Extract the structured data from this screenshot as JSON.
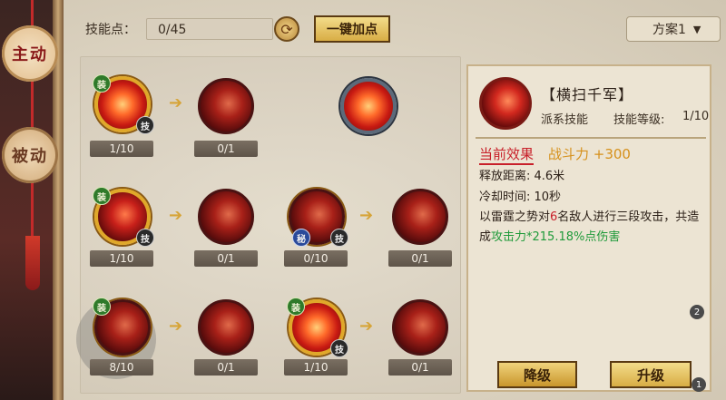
{
  "tabs": {
    "active": "主动",
    "inactive": "被动"
  },
  "topbar": {
    "skill_points_label": "技能点：",
    "skill_points_value": "0/45",
    "quick_assign_label": "一键加点",
    "plan_label": "方案1",
    "plan_chevron": "▼"
  },
  "skills": [
    {
      "level": "1/10",
      "badges": [
        "装",
        "技"
      ]
    },
    {
      "level": "0/1",
      "badges": []
    },
    {
      "level": "",
      "badges": []
    },
    {
      "level": "1/10",
      "badges": [
        "装",
        "技"
      ]
    },
    {
      "level": "0/1",
      "badges": []
    },
    {
      "level": "0/10",
      "badges": [
        "秘",
        "技"
      ]
    },
    {
      "level": "0/1",
      "badges": []
    },
    {
      "level": "8/10",
      "badges": [
        "装"
      ]
    },
    {
      "level": "0/1",
      "badges": []
    },
    {
      "level": "1/10",
      "badges": [
        "装",
        "技"
      ]
    },
    {
      "level": "0/1",
      "badges": []
    }
  ],
  "detail": {
    "name": "【横扫千军】",
    "type": "派系技能",
    "level_label": "技能等级:",
    "level_value": "1/10",
    "effect_title": "当前效果",
    "effect_value": "战斗力 +300",
    "range": "释放距离: 4.6米",
    "cooldown": "冷却时间: 10秒",
    "desc_prefix": "以雷霆之势对",
    "desc_count": "6",
    "desc_middle": "名敌人进行三段攻击，共造成",
    "desc_damage": "攻击力*215.18%点伤害"
  },
  "buttons": {
    "downgrade": "降级",
    "upgrade": "升级"
  },
  "markers": {
    "two": "2",
    "one": "1"
  },
  "colors": {
    "accent_red": "#c8202a",
    "accent_gold": "#d6901a",
    "accent_green": "#1f9a3a"
  }
}
